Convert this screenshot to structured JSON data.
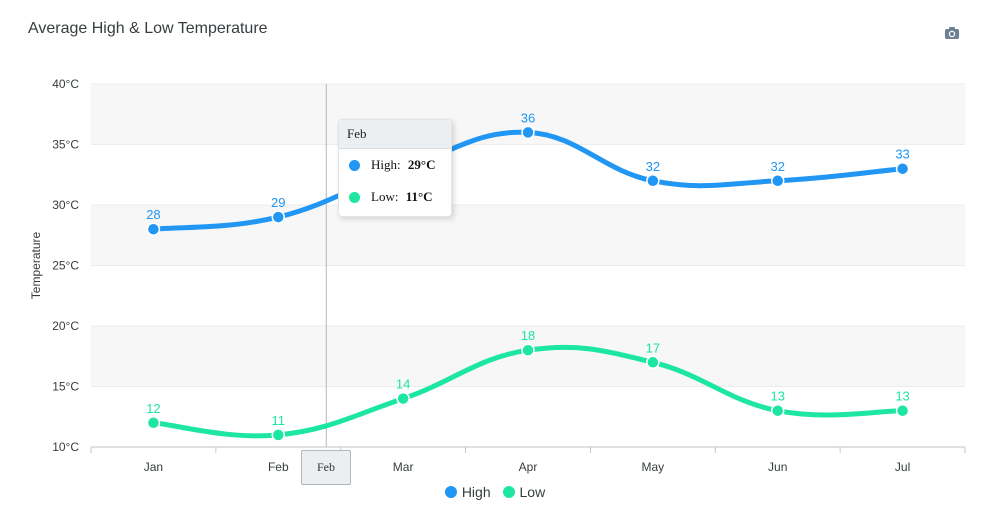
{
  "chart_data": {
    "type": "line",
    "title": "Average High & Low Temperature",
    "xlabel": "",
    "ylabel": "Temperature",
    "categories": [
      "Jan",
      "Feb",
      "Mar",
      "Apr",
      "May",
      "Jun",
      "Jul"
    ],
    "series": [
      {
        "name": "High",
        "values": [
          28,
          29,
          33,
          36,
          32,
          32,
          33
        ],
        "color": "#2196f3"
      },
      {
        "name": "Low",
        "values": [
          12,
          11,
          14,
          18,
          17,
          13,
          13
        ],
        "color": "#1de6a0"
      }
    ],
    "y_ticks": [
      "40°C",
      "35°C",
      "30°C",
      "25°C",
      "20°C",
      "15°C",
      "10°C"
    ],
    "ylim": [
      10,
      40
    ],
    "grid": true,
    "legend_position": "bottom-center",
    "data_labels": true
  },
  "toolbar": {
    "icon": "camera-icon"
  },
  "tooltip": {
    "header": "Feb",
    "rows": [
      {
        "label": "High:",
        "value": "29°C",
        "color": "#2196f3"
      },
      {
        "label": "Low:",
        "value": "11°C",
        "color": "#1de6a0"
      }
    ]
  },
  "crosshair_label": "Feb"
}
